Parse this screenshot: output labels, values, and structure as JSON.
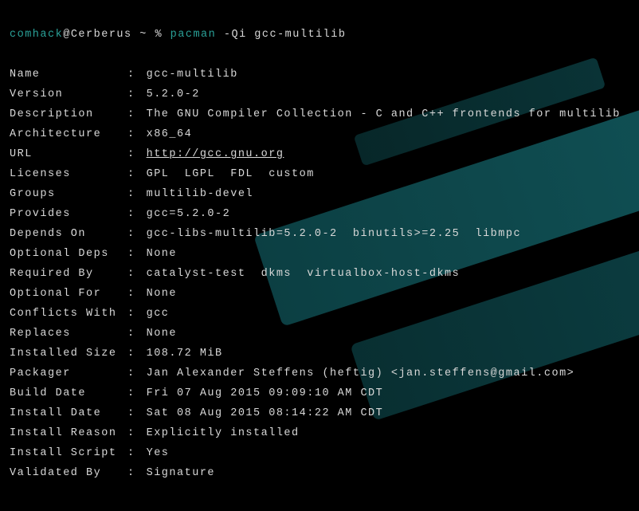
{
  "prompt": {
    "user": "comhack",
    "at": "@",
    "host": "Cerberus",
    "path_sep": " ~ % ",
    "command": "pacman",
    "args": " -Qi gcc-multilib"
  },
  "rows": [
    {
      "label": "Name",
      "value": "gcc-multilib"
    },
    {
      "label": "Version",
      "value": "5.2.0-2"
    },
    {
      "label": "Description",
      "value": "The GNU Compiler Collection - C and C++ frontends for multilib"
    },
    {
      "label": "Architecture",
      "value": "x86_64"
    },
    {
      "label": "URL",
      "value": "http://gcc.gnu.org",
      "is_url": true
    },
    {
      "label": "Licenses",
      "value": "GPL  LGPL  FDL  custom"
    },
    {
      "label": "Groups",
      "value": "multilib-devel"
    },
    {
      "label": "Provides",
      "value": "gcc=5.2.0-2"
    },
    {
      "label": "Depends On",
      "value": "gcc-libs-multilib=5.2.0-2  binutils>=2.25  libmpc"
    },
    {
      "label": "Optional Deps",
      "value": "None"
    },
    {
      "label": "Required By",
      "value": "catalyst-test  dkms  virtualbox-host-dkms"
    },
    {
      "label": "Optional For",
      "value": "None"
    },
    {
      "label": "Conflicts With",
      "value": "gcc"
    },
    {
      "label": "Replaces",
      "value": "None"
    },
    {
      "label": "Installed Size",
      "value": "108.72 MiB"
    },
    {
      "label": "Packager",
      "value": "Jan Alexander Steffens (heftig) <jan.steffens@gmail.com>"
    },
    {
      "label": "Build Date",
      "value": "Fri 07 Aug 2015 09:09:10 AM CDT"
    },
    {
      "label": "Install Date",
      "value": "Sat 08 Aug 2015 08:14:22 AM CDT"
    },
    {
      "label": "Install Reason",
      "value": "Explicitly installed"
    },
    {
      "label": "Install Script",
      "value": "Yes"
    },
    {
      "label": "Validated By",
      "value": "Signature"
    }
  ]
}
